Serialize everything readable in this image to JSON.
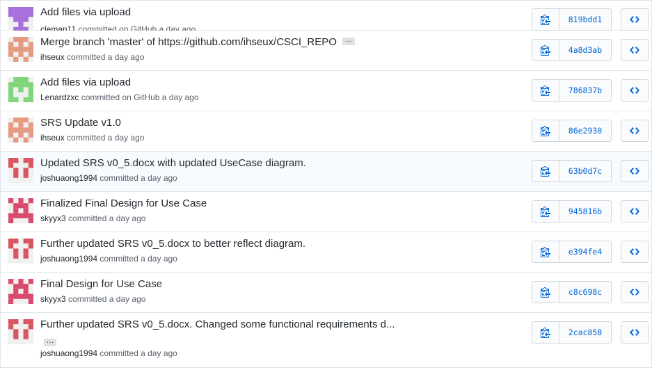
{
  "commits": [
    {
      "message": "Add files via upload",
      "author": "cleman11",
      "action": "committed on GitHub",
      "time": "a day ago",
      "sha": "819bdd1",
      "avatar_color": "#a66fdc",
      "avatar_icon": "pixel-identicon"
    },
    {
      "message": "Merge branch 'master' of https://github.com/ihseux/CSCI_REPO",
      "ellipsis": "…",
      "author": "ihseux",
      "action": "committed",
      "time": "a day ago",
      "sha": "4a8d3ab",
      "avatar_color": "#e59a82",
      "avatar_icon": "pixel-identicon"
    },
    {
      "message": "Add files via upload",
      "author": "Lenardzxc",
      "action": "committed on GitHub",
      "time": "a day ago",
      "sha": "786837b",
      "avatar_color": "#7fd57a",
      "avatar_icon": "pixel-identicon"
    },
    {
      "message": "SRS Update v1.0",
      "author": "ihseux",
      "action": "committed",
      "time": "a day ago",
      "sha": "86e2930",
      "avatar_color": "#e59a82",
      "avatar_icon": "pixel-identicon"
    },
    {
      "message": "Updated SRS v0_5.docx with updated UseCase diagram.",
      "author": "joshuaong1994",
      "action": "committed",
      "time": "a day ago",
      "sha": "63b0d7c",
      "avatar_color": "#d9545e",
      "avatar_icon": "pixel-identicon"
    },
    {
      "message": "Finalized Final Design for Use Case",
      "author": "skyyx3",
      "action": "committed",
      "time": "a day ago",
      "sha": "945816b",
      "avatar_color": "#d94b6c",
      "avatar_icon": "pixel-identicon"
    },
    {
      "message": "Further updated SRS v0_5.docx to better reflect diagram.",
      "author": "joshuaong1994",
      "action": "committed",
      "time": "a day ago",
      "sha": "e394fe4",
      "avatar_color": "#d9545e",
      "avatar_icon": "pixel-identicon"
    },
    {
      "message": "Final Design for Use Case",
      "author": "skyyx3",
      "action": "committed",
      "time": "a day ago",
      "sha": "c8c698c",
      "avatar_color": "#d94b6c",
      "avatar_icon": "pixel-identicon"
    },
    {
      "message": "Further updated SRS v0_5.docx. Changed some functional requirements d...",
      "ellipsis": "…",
      "author": "joshuaong1994",
      "action": "committed",
      "time": "a day ago",
      "sha": "2cac858",
      "avatar_color": "#d9545e",
      "avatar_icon": "pixel-identicon"
    }
  ],
  "icons": {
    "copy": "clippy-icon",
    "browse": "code-icon"
  },
  "colors": {
    "link": "#0366d6",
    "border": "#e1e4e8",
    "highlight_row": "#f6fbff"
  }
}
